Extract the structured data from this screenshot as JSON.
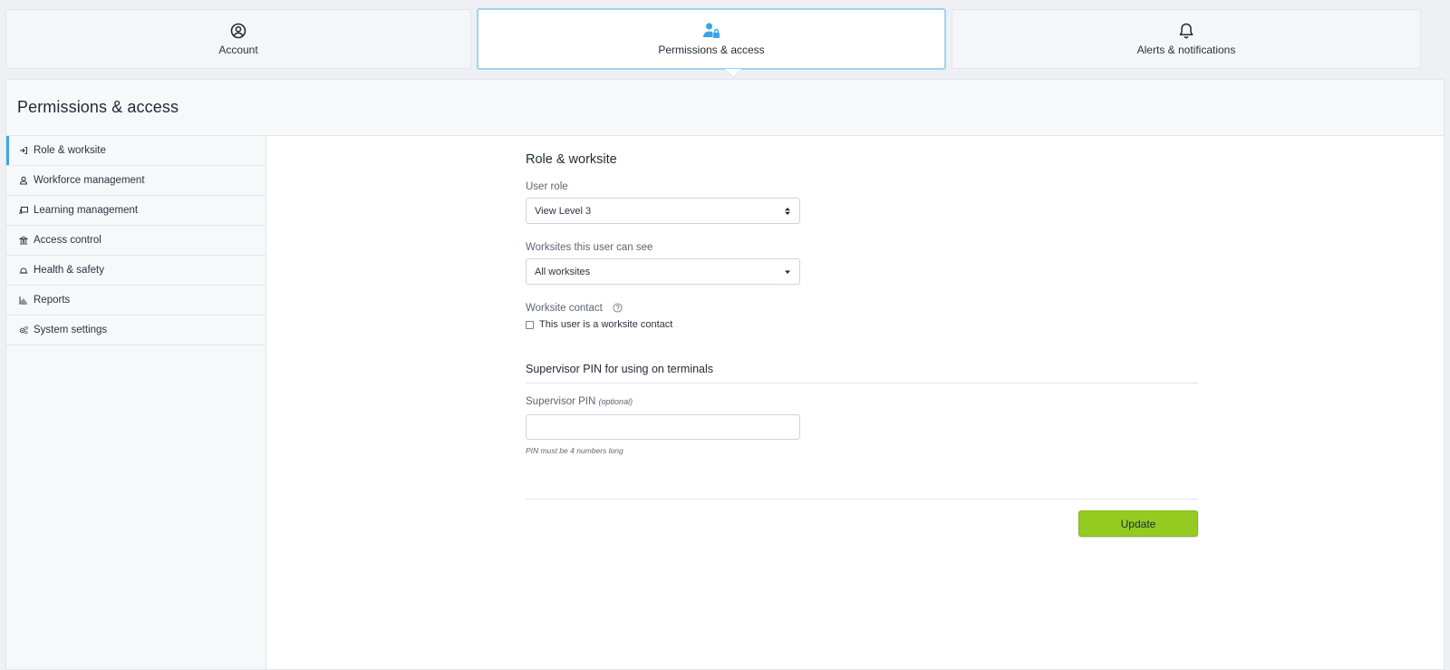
{
  "tabs": [
    {
      "label": "Account",
      "icon": "user-circle-icon"
    },
    {
      "label": "Permissions & access",
      "icon": "user-lock-icon"
    },
    {
      "label": "Alerts & notifications",
      "icon": "bell-icon"
    }
  ],
  "panel": {
    "title": "Permissions & access"
  },
  "sidebar": {
    "items": [
      {
        "label": "Role & worksite",
        "icon": "sign-in-icon"
      },
      {
        "label": "Workforce management",
        "icon": "user-icon"
      },
      {
        "label": "Learning management",
        "icon": "chalkboard-icon"
      },
      {
        "label": "Access control",
        "icon": "building-icon"
      },
      {
        "label": "Health & safety",
        "icon": "hard-hat-icon"
      },
      {
        "label": "Reports",
        "icon": "chart-icon"
      },
      {
        "label": "System settings",
        "icon": "cogs-icon"
      }
    ]
  },
  "form": {
    "section_title": "Role & worksite",
    "user_role": {
      "label": "User role",
      "value": "View Level 3"
    },
    "worksites": {
      "label": "Worksites this user can see",
      "value": "All worksites"
    },
    "worksite_contact": {
      "label": "Worksite contact",
      "checkbox_label": "This user is a worksite contact",
      "checked": false
    },
    "pin_section_title": "Supervisor PIN for using on terminals",
    "pin": {
      "label": "Supervisor PIN",
      "optional": "(optional)",
      "value": "",
      "hint": "PIN must be 4 numbers long"
    },
    "update_label": "Update"
  },
  "colors": {
    "accent": "#3aa6e8",
    "button": "#95cb21",
    "active_border": "#9fd3f4"
  }
}
